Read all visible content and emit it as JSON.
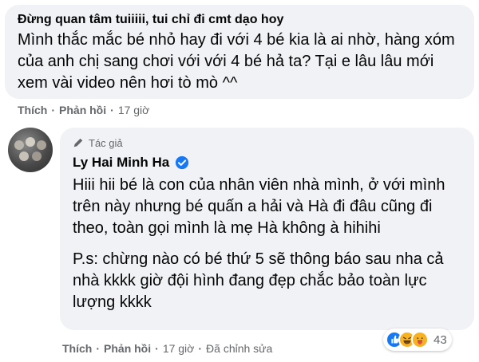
{
  "comment1": {
    "author": "Đừng quan tâm tuiiiii, tui chỉ đi cmt dạo hoy",
    "text": "Mình thắc mắc bé nhỏ hay đi với 4 bé kia là ai nhờ, hàng xóm của anh chị sang chơi với với 4 bé hả ta? Tại e lâu lâu mới xem vài video nên hơi tò mò ^^",
    "actions": {
      "like": "Thích",
      "reply": "Phản hồi",
      "time": "17 giờ"
    }
  },
  "reply": {
    "tag": "Tác giả",
    "author": "Ly Hai Minh Ha",
    "verified_color": "#1877f2",
    "paragraphs": [
      "Hiii hii bé là con của nhân viên nhà mình, ở với mình trên này nhưng bé quấn a hải và Hà đi đâu cũng đi theo, toàn gọi mình là mẹ Hà không à hihihi",
      "P.s: chừng nào có bé thứ 5 sẽ thông báo sau nha cả nhà kkkk giờ đội hình đang đẹp chắc bảo toàn lực lượng kkkk"
    ],
    "actions": {
      "like": "Thích",
      "reply": "Phản hồi",
      "time": "17 giờ",
      "edited": "Đã chỉnh sửa"
    },
    "reactions": {
      "icons": [
        "like-icon",
        "haha-icon",
        "care-icon"
      ],
      "count": "43"
    }
  }
}
